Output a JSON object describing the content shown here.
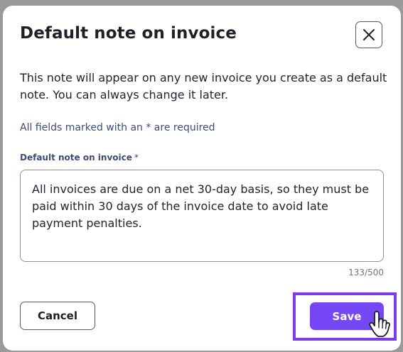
{
  "dialog": {
    "title": "Default note on invoice",
    "close_icon": "close-icon",
    "intro": "This note will appear on any new invoice you create as a default note. You can always change it later.",
    "required_notice": "All fields marked with an * are required",
    "field": {
      "label": "Default note on invoice",
      "required_marker": "*",
      "value": "All invoices are due on a net 30-day basis, so they must be paid within 30 days of the invoice date to avoid late payment penalties.",
      "counter": "133/500"
    },
    "buttons": {
      "cancel": "Cancel",
      "save": "Save"
    },
    "cursor_icon": "hand-pointer-icon",
    "colors": {
      "accent": "#7647f5",
      "highlight": "#7c3aed",
      "text": "#23232f",
      "label": "#3d4b78"
    }
  }
}
